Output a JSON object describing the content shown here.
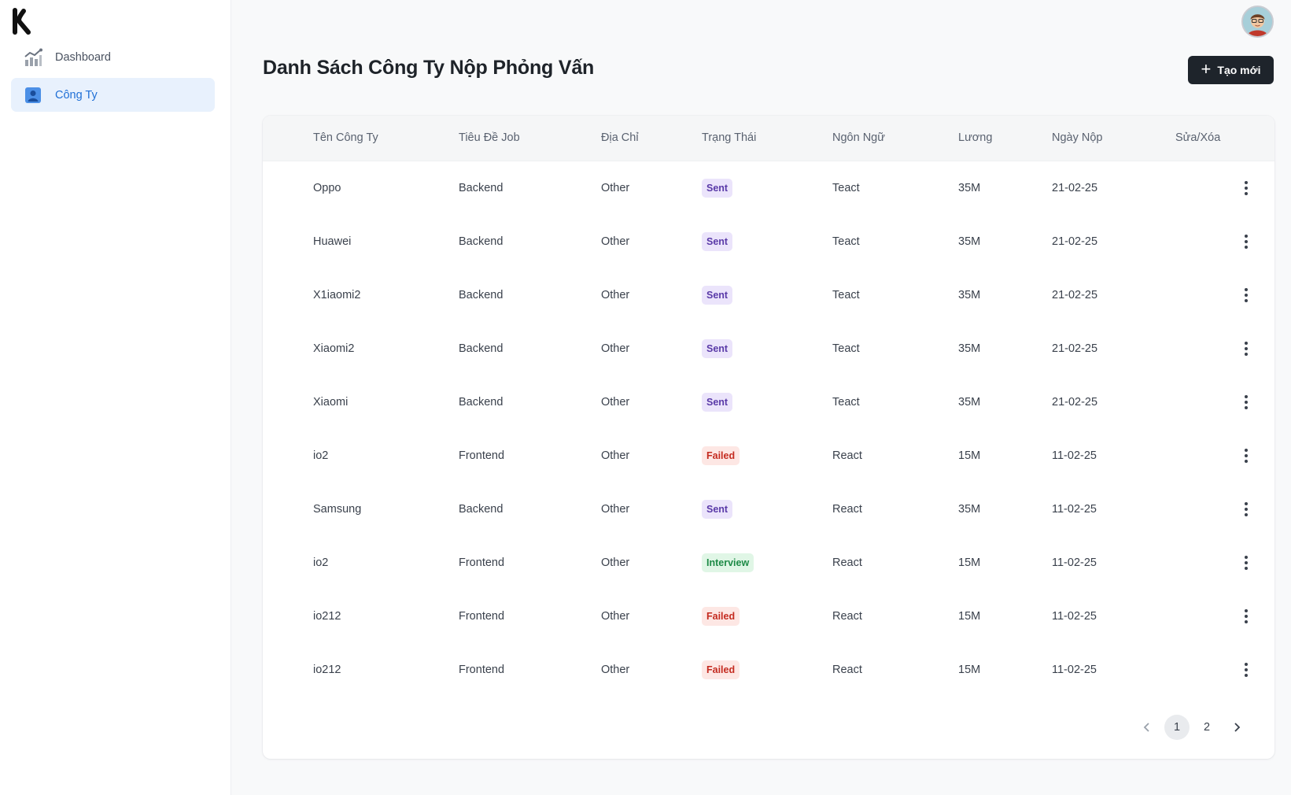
{
  "sidebar": {
    "items": [
      {
        "label": "Dashboard",
        "icon": "chart-icon"
      },
      {
        "label": "Công Ty",
        "icon": "user-card-icon"
      }
    ]
  },
  "header": {
    "title": "Danh Sách Công Ty Nộp Phỏng Vấn",
    "create_label": "Tạo mới",
    "create_icon": "plus-icon"
  },
  "colors": {
    "accent": "#1f6fd6",
    "button_dark": "#1e242b",
    "sent": "#5a3aa8",
    "failed": "#c42b20",
    "interview": "#1d8a46"
  },
  "table": {
    "columns": [
      "Tên Công Ty",
      "Tiêu Đề Job",
      "Địa Chỉ",
      "Trạng Thái",
      "Ngôn Ngữ",
      "Lương",
      "Ngày Nộp",
      "Sửa/Xóa"
    ],
    "rows": [
      {
        "company": "Oppo",
        "job": "Backend",
        "address": "Other",
        "status": "Sent",
        "lang": "Teact",
        "salary": "35M",
        "date": "21-02-25"
      },
      {
        "company": "Huawei",
        "job": "Backend",
        "address": "Other",
        "status": "Sent",
        "lang": "Teact",
        "salary": "35M",
        "date": "21-02-25"
      },
      {
        "company": "X1iaomi2",
        "job": "Backend",
        "address": "Other",
        "status": "Sent",
        "lang": "Teact",
        "salary": "35M",
        "date": "21-02-25"
      },
      {
        "company": "Xiaomi2",
        "job": "Backend",
        "address": "Other",
        "status": "Sent",
        "lang": "Teact",
        "salary": "35M",
        "date": "21-02-25"
      },
      {
        "company": "Xiaomi",
        "job": "Backend",
        "address": "Other",
        "status": "Sent",
        "lang": "Teact",
        "salary": "35M",
        "date": "21-02-25"
      },
      {
        "company": "io2",
        "job": "Frontend",
        "address": "Other",
        "status": "Failed",
        "lang": "React",
        "salary": "15M",
        "date": "11-02-25"
      },
      {
        "company": "Samsung",
        "job": "Backend",
        "address": "Other",
        "status": "Sent",
        "lang": "React",
        "salary": "35M",
        "date": "11-02-25"
      },
      {
        "company": "io2",
        "job": "Frontend",
        "address": "Other",
        "status": "Interview",
        "lang": "React",
        "salary": "15M",
        "date": "11-02-25"
      },
      {
        "company": "io212",
        "job": "Frontend",
        "address": "Other",
        "status": "Failed",
        "lang": "React",
        "salary": "15M",
        "date": "11-02-25"
      },
      {
        "company": "io212",
        "job": "Frontend",
        "address": "Other",
        "status": "Failed",
        "lang": "React",
        "salary": "15M",
        "date": "11-02-25"
      }
    ]
  },
  "pagination": {
    "pages": [
      "1",
      "2"
    ],
    "current": "1",
    "prev_icon": "chevron-left-icon",
    "next_icon": "chevron-right-icon"
  }
}
